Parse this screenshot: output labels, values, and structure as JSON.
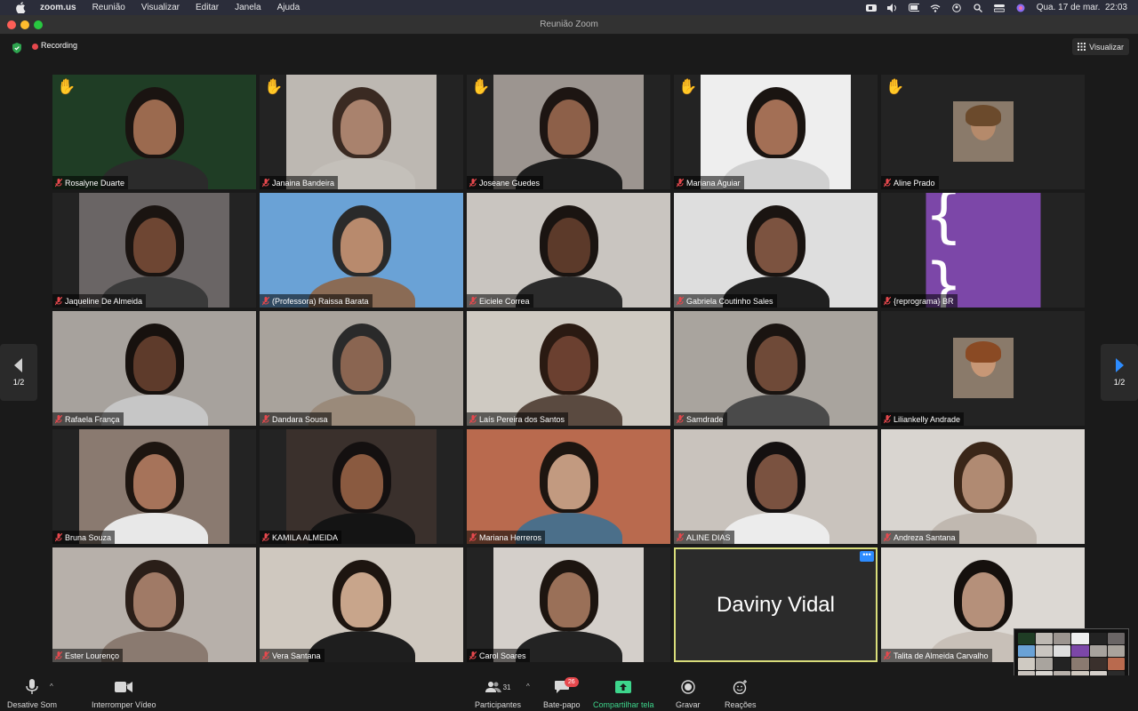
{
  "menubar": {
    "app": "zoom.us",
    "items": [
      "Reunião",
      "Visualizar",
      "Editar",
      "Janela",
      "Ajuda"
    ],
    "datetime": "Qua. 17 de mar.  22:03"
  },
  "window": {
    "title": "Reunião Zoom"
  },
  "topbar": {
    "recording_label": "Recording",
    "view_label": "Visualizar"
  },
  "pagination": {
    "left": "1/2",
    "right": "1/2"
  },
  "speaker": {
    "name": "Daviny Vidal"
  },
  "participants": [
    {
      "name": "Rosalyne Duarte",
      "hand": true,
      "bg": "#1f3d25",
      "skin": "#9b6a4f",
      "hair": "#1a1411",
      "layout": "full",
      "shirt": "#2b2b2b"
    },
    {
      "name": "Janaina Bandeira",
      "hand": true,
      "bg": "#bdb8b2",
      "skin": "#a9826d",
      "hair": "#3a2a22",
      "layout": "narrow",
      "shirt": "#c4c0ba"
    },
    {
      "name": "Joseane Guedes",
      "hand": true,
      "bg": "#9c9590",
      "skin": "#8d6049",
      "hair": "#1d1512",
      "layout": "narrow",
      "shirt": "#1e1e1e"
    },
    {
      "name": "Mariana Aguiar",
      "hand": true,
      "bg": "#eeeeee",
      "skin": "#a36f55",
      "hair": "#1a1411",
      "layout": "narrow",
      "shirt": "#d0d0d0"
    },
    {
      "name": "Aline Prado",
      "hand": true,
      "bg": "#232323",
      "skin": "#b58a6b",
      "hair": "#6b4a2c",
      "layout": "avatar",
      "shirt": "#2e2e2e"
    },
    {
      "name": "Jaqueline De Almeida",
      "hand": false,
      "bg": "#6a6565",
      "skin": "#6e4633",
      "hair": "#1a1411",
      "layout": "narrow",
      "shirt": "#3a3a3a"
    },
    {
      "name": "(Professora) Raissa Barata",
      "hand": false,
      "bg": "#6aa2d6",
      "skin": "#b88a6d",
      "hair": "#2a2a2a",
      "layout": "full",
      "shirt": "#8a6b55"
    },
    {
      "name": "Eiciele Correa",
      "hand": false,
      "bg": "#c9c5c0",
      "skin": "#5c3a2a",
      "hair": "#1a1411",
      "layout": "full",
      "shirt": "#2b2b2b"
    },
    {
      "name": "Gabriela Coutinho Sales",
      "hand": false,
      "bg": "#dedede",
      "skin": "#7c5340",
      "hair": "#1a1411",
      "layout": "full",
      "shirt": "#202020"
    },
    {
      "name": "{reprograma} BR",
      "hand": false,
      "bg": "#232323",
      "layout": "brand",
      "logo": "{ }"
    },
    {
      "name": "Rafaela França",
      "hand": false,
      "bg": "#a7a29d",
      "skin": "#5e3b2b",
      "hair": "#17110e",
      "layout": "full",
      "shirt": "#c6c6c6"
    },
    {
      "name": "Dandara Sousa",
      "hand": false,
      "bg": "#a9a39c",
      "skin": "#8a6551",
      "hair": "#2a2a2a",
      "layout": "full",
      "shirt": "#9a8a7a"
    },
    {
      "name": "Laís Pereira dos Santos",
      "hand": false,
      "bg": "#cfcac2",
      "skin": "#6b4030",
      "hair": "#2a1a12",
      "layout": "full",
      "shirt": "#5a4a40"
    },
    {
      "name": "Samdrade",
      "hand": false,
      "bg": "#a9a49e",
      "skin": "#6f4a38",
      "hair": "#1a1411",
      "layout": "full",
      "shirt": "#4a4a4a"
    },
    {
      "name": "Liliankelly Andrade",
      "hand": false,
      "bg": "#232323",
      "skin": "#c79776",
      "hair": "#8a4a24",
      "layout": "avatar",
      "shirt": "#2e2e2e"
    },
    {
      "name": "Bruna Souza",
      "hand": false,
      "bg": "#8a7a70",
      "skin": "#a6735a",
      "hair": "#1d1510",
      "layout": "narrow",
      "shirt": "#e8e8e8"
    },
    {
      "name": "KAMILA ALMEIDA",
      "hand": false,
      "bg": "#3a302c",
      "skin": "#8a5a40",
      "hair": "#141010",
      "layout": "narrow",
      "shirt": "#141414"
    },
    {
      "name": "Mariana Herreros",
      "hand": false,
      "bg": "#b96a4e",
      "skin": "#c29a80",
      "hair": "#1d1510",
      "layout": "full",
      "shirt": "#4b6f8a"
    },
    {
      "name": "ALINE DIAS",
      "hand": false,
      "bg": "#c9c3bd",
      "skin": "#7a5240",
      "hair": "#141010",
      "layout": "full",
      "shirt": "#ececec"
    },
    {
      "name": "Andreza Santana",
      "hand": false,
      "bg": "#d9d5d0",
      "skin": "#b08a72",
      "hair": "#3a2618",
      "layout": "full",
      "shirt": "#c0b8b0"
    },
    {
      "name": "Ester Lourenço",
      "hand": false,
      "bg": "#b7b0aa",
      "skin": "#a07a66",
      "hair": "#2a1e18",
      "layout": "full",
      "shirt": "#8a7a70"
    },
    {
      "name": "Vera Santana",
      "hand": false,
      "bg": "#cfc8bf",
      "skin": "#c8a58b",
      "hair": "#1d1510",
      "layout": "full",
      "shirt": "#1e1e1e"
    },
    {
      "name": "Carol Soares",
      "hand": false,
      "bg": "#d4cfca",
      "skin": "#9a7058",
      "hair": "#1d1510",
      "layout": "narrow",
      "shirt": "#232323"
    },
    {
      "name": "Daviny Vidal",
      "hand": false,
      "layout": "speaker"
    },
    {
      "name": "Talita de Almeida Carvalho",
      "hand": false,
      "bg": "#dcd8d3",
      "skin": "#b5907a",
      "hair": "#15100d",
      "layout": "full",
      "shirt": "#c8c0b8"
    }
  ],
  "toolbar": {
    "mute_label": "Desative Som",
    "video_label": "Interromper Vídeo",
    "participants_label": "Participantes",
    "participants_count": "31",
    "chat_label": "Bate-papo",
    "chat_badge": "26",
    "share_label": "Compartilhar tela",
    "record_label": "Gravar",
    "reactions_label": "Reações"
  },
  "colors": {
    "speaker_outline": "#d8dd7a",
    "recording": "#e5484d",
    "share": "#3dd68c",
    "accent": "#2d8cff",
    "brand": "#7c47a8"
  }
}
